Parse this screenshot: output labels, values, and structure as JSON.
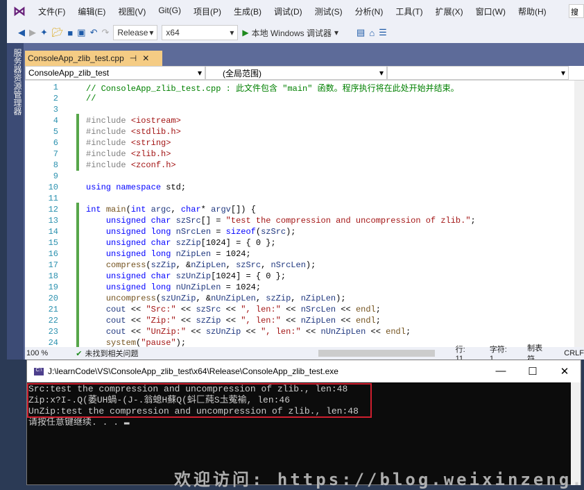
{
  "menu": [
    "文件(F)",
    "编辑(E)",
    "视图(V)",
    "Git(G)",
    "项目(P)",
    "生成(B)",
    "调试(D)",
    "测试(S)",
    "分析(N)",
    "工具(T)",
    "扩展(X)",
    "窗口(W)",
    "帮助(H)"
  ],
  "search": "搜",
  "toolbar": {
    "config": "Release",
    "platform": "x64",
    "run": "本地 Windows 调试器"
  },
  "side_panel": "服务器资源管理器",
  "tab": {
    "label": "ConsoleApp_zlib_test.cpp",
    "pin": "⊣",
    "close": "✕"
  },
  "nav": {
    "project": "ConsoleApp_zlib_test",
    "scope": "(全局范围)",
    "member": ""
  },
  "code": [
    [
      [
        "c",
        "// ConsoleApp_zlib_test.cpp : 此文件包含 \"main\" 函数。程序执行将在此处开始并结束。"
      ]
    ],
    [
      [
        "c",
        "//"
      ]
    ],
    [],
    [
      [
        "p",
        "#include "
      ],
      [
        "s",
        "<iostream>"
      ]
    ],
    [
      [
        "p",
        "#include "
      ],
      [
        "s",
        "<stdlib.h>"
      ]
    ],
    [
      [
        "p",
        "#include "
      ],
      [
        "s",
        "<string>"
      ]
    ],
    [
      [
        "p",
        "#include "
      ],
      [
        "s",
        "<zlib.h>"
      ]
    ],
    [
      [
        "p",
        "#include "
      ],
      [
        "s",
        "<zconf.h>"
      ]
    ],
    [],
    [
      [
        "k",
        "using namespace "
      ],
      [
        "",
        "std;"
      ]
    ],
    [],
    [
      [
        "k",
        "int "
      ],
      [
        "f",
        "main"
      ],
      [
        "",
        "("
      ],
      [
        "k",
        "int "
      ],
      [
        "v",
        "argc"
      ],
      [
        "",
        ", "
      ],
      [
        "k",
        "char"
      ],
      [
        "",
        "* "
      ],
      [
        "v",
        "argv"
      ],
      [
        "",
        "[]) {"
      ]
    ],
    [
      [
        "",
        "    "
      ],
      [
        "k",
        "unsigned char "
      ],
      [
        "v",
        "szSrc"
      ],
      [
        "",
        "[] = "
      ],
      [
        "s",
        "\"test the compression and uncompression of zlib.\""
      ],
      [
        "",
        ";"
      ]
    ],
    [
      [
        "",
        "    "
      ],
      [
        "k",
        "unsigned long "
      ],
      [
        "v",
        "nSrcLen"
      ],
      [
        "",
        " = "
      ],
      [
        "k",
        "sizeof"
      ],
      [
        "",
        "("
      ],
      [
        "v",
        "szSrc"
      ],
      [
        "",
        ");"
      ]
    ],
    [
      [
        "",
        "    "
      ],
      [
        "k",
        "unsigned char "
      ],
      [
        "v",
        "szZip"
      ],
      [
        "",
        "[1024] = { 0 };"
      ]
    ],
    [
      [
        "",
        "    "
      ],
      [
        "k",
        "unsigned long "
      ],
      [
        "v",
        "nZipLen"
      ],
      [
        "",
        " = 1024;"
      ]
    ],
    [
      [
        "",
        "    "
      ],
      [
        "f",
        "compress"
      ],
      [
        "",
        "("
      ],
      [
        "v",
        "szZip"
      ],
      [
        "",
        ", &"
      ],
      [
        "v",
        "nZipLen"
      ],
      [
        "",
        ", "
      ],
      [
        "v",
        "szSrc"
      ],
      [
        "",
        ", "
      ],
      [
        "v",
        "nSrcLen"
      ],
      [
        "",
        ");"
      ]
    ],
    [
      [
        "",
        "    "
      ],
      [
        "k",
        "unsigned char "
      ],
      [
        "v",
        "szUnZip"
      ],
      [
        "",
        "[1024] = { 0 };"
      ]
    ],
    [
      [
        "",
        "    "
      ],
      [
        "k",
        "unsigned long "
      ],
      [
        "v",
        "nUnZipLen"
      ],
      [
        "",
        " = 1024;"
      ]
    ],
    [
      [
        "",
        "    "
      ],
      [
        "f",
        "uncompress"
      ],
      [
        "",
        "("
      ],
      [
        "v",
        "szUnZip"
      ],
      [
        "",
        ", &"
      ],
      [
        "v",
        "nUnZipLen"
      ],
      [
        "",
        ", "
      ],
      [
        "v",
        "szZip"
      ],
      [
        "",
        ", "
      ],
      [
        "v",
        "nZipLen"
      ],
      [
        "",
        ");"
      ]
    ],
    [
      [
        "",
        "    "
      ],
      [
        "v",
        "cout"
      ],
      [
        "",
        " << "
      ],
      [
        "s",
        "\"Src:\""
      ],
      [
        "",
        " << "
      ],
      [
        "v",
        "szSrc"
      ],
      [
        "",
        " << "
      ],
      [
        "s",
        "\", len:\""
      ],
      [
        "",
        " << "
      ],
      [
        "v",
        "nSrcLen"
      ],
      [
        "",
        " << "
      ],
      [
        "f",
        "endl"
      ],
      [
        "",
        ";"
      ]
    ],
    [
      [
        "",
        "    "
      ],
      [
        "v",
        "cout"
      ],
      [
        "",
        " << "
      ],
      [
        "s",
        "\"Zip:\""
      ],
      [
        "",
        " << "
      ],
      [
        "v",
        "szZip"
      ],
      [
        "",
        " << "
      ],
      [
        "s",
        "\", len:\""
      ],
      [
        "",
        " << "
      ],
      [
        "v",
        "nZipLen"
      ],
      [
        "",
        " << "
      ],
      [
        "f",
        "endl"
      ],
      [
        "",
        ";"
      ]
    ],
    [
      [
        "",
        "    "
      ],
      [
        "v",
        "cout"
      ],
      [
        "",
        " << "
      ],
      [
        "s",
        "\"UnZip:\""
      ],
      [
        "",
        " << "
      ],
      [
        "v",
        "szUnZip"
      ],
      [
        "",
        " << "
      ],
      [
        "s",
        "\", len:\""
      ],
      [
        "",
        " << "
      ],
      [
        "v",
        "nUnZipLen"
      ],
      [
        "",
        " << "
      ],
      [
        "f",
        "endl"
      ],
      [
        "",
        ";"
      ]
    ],
    [
      [
        "",
        "    "
      ],
      [
        "f",
        "system"
      ],
      [
        "",
        "("
      ],
      [
        "s",
        "\"pause\""
      ],
      [
        "",
        ");"
      ]
    ]
  ],
  "status": {
    "zoom": "100 %",
    "issues": "未找到相关问题",
    "line": "行: 11",
    "char": "字符: 1",
    "tabs": "制表符",
    "eol": "CRLF"
  },
  "console": {
    "title": "J:\\learnCode\\VS\\ConsoleApp_zlib_test\\x64\\Release\\ConsoleApp_zlib_test.exe",
    "lines": [
      "Src:test the compression and uncompression of zlib., len:48",
      "Zip:x?I-.Q(萎UH蝸-(J-.翁螅H蘇Q(蚪匚蒓S圡蒬褕, len:46",
      "UnZip:test the compression and uncompression of zlib., len:48",
      "请按任意键继续. . ."
    ],
    "watermark": "欢迎访问: https://blog.weixinzeng.cn"
  }
}
